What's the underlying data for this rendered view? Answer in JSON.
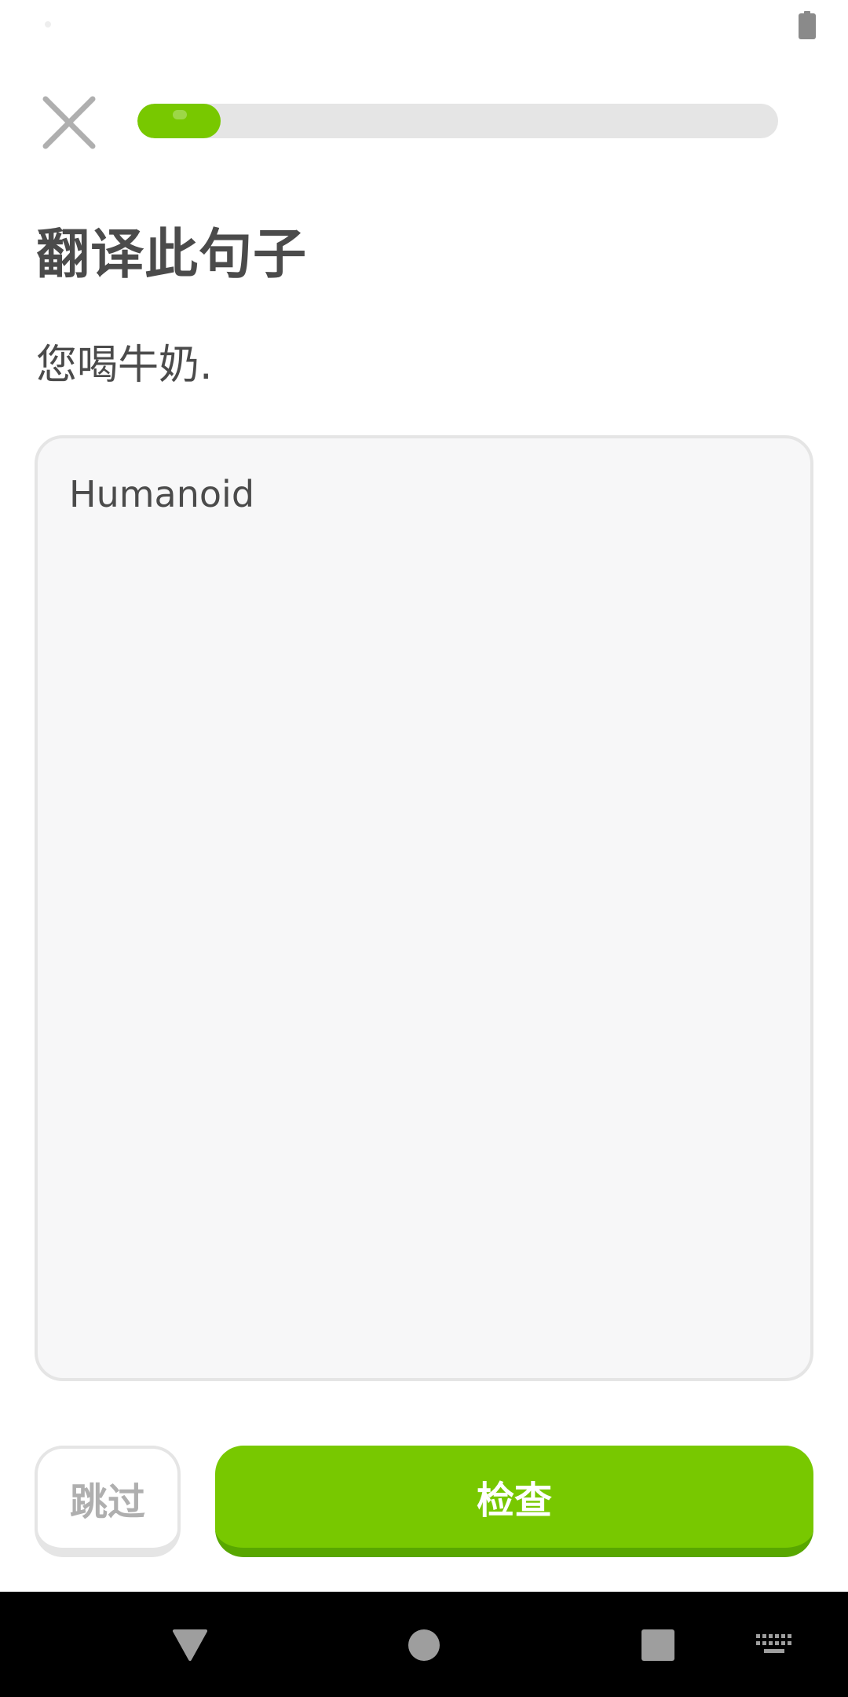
{
  "exercise": {
    "title": "翻译此句子",
    "prompt": "您喝牛奶.",
    "answer_text": "Humanoid",
    "progress_fraction": 0.13
  },
  "buttons": {
    "skip_label": "跳过",
    "check_label": "检查"
  },
  "icons": {
    "close": "close-icon",
    "battery": "battery-icon",
    "nav_back": "triangle-back-icon",
    "nav_home": "circle-home-icon",
    "nav_recents": "square-recents-icon",
    "nav_keyboard": "keyboard-icon"
  },
  "colors": {
    "accent_green": "#78c800",
    "accent_green_shadow": "#58a700",
    "text_dark": "#4b4b4b",
    "border_gray": "#e5e5e5"
  }
}
